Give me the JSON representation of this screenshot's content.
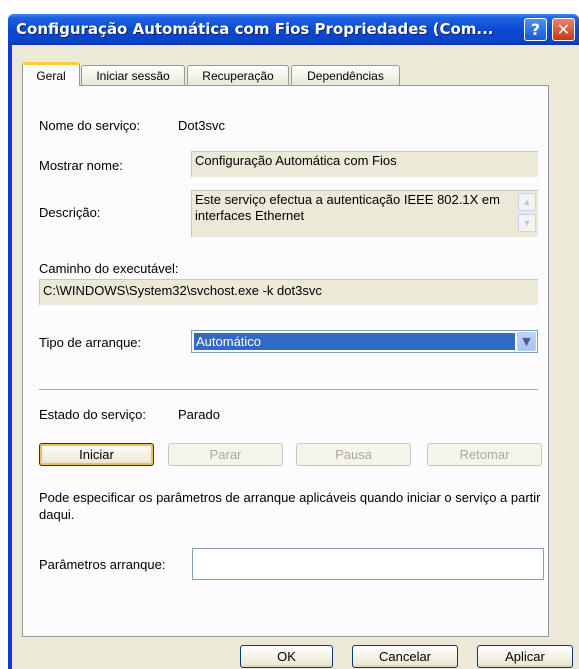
{
  "window": {
    "title": "Configuração Automática com Fios Propriedades (Com...",
    "help_label": "?",
    "close_label": "✕"
  },
  "tabs": [
    {
      "label": "Geral",
      "active": true
    },
    {
      "label": "Iniciar sessão",
      "active": false
    },
    {
      "label": "Recuperação",
      "active": false
    },
    {
      "label": "Dependências",
      "active": false
    }
  ],
  "general": {
    "service_name_label": "Nome do serviço:",
    "service_name_value": "Dot3svc",
    "display_name_label": "Mostrar nome:",
    "display_name_value": "Configuração Automática com Fios",
    "description_label": "Descrição:",
    "description_value": "Este serviço efectua a autenticação IEEE 802.1X em interfaces Ethernet",
    "path_label": "Caminho do executável:",
    "path_value": "C:\\WINDOWS\\System32\\svchost.exe -k dot3svc",
    "startup_type_label": "Tipo de arranque:",
    "startup_type_value": "Automático",
    "status_label": "Estado do serviço:",
    "status_value": "Parado",
    "start_button": "Iniciar",
    "stop_button": "Parar",
    "pause_button": "Pausa",
    "resume_button": "Retomar",
    "info_text": "Pode especificar os parâmetros de arranque aplicáveis quando iniciar o serviço a partir daqui.",
    "params_label": "Parâmetros arranque:",
    "params_value": ""
  },
  "footer": {
    "ok_button": "OK",
    "cancel_button": "Cancelar",
    "apply_button": "Aplicar"
  }
}
